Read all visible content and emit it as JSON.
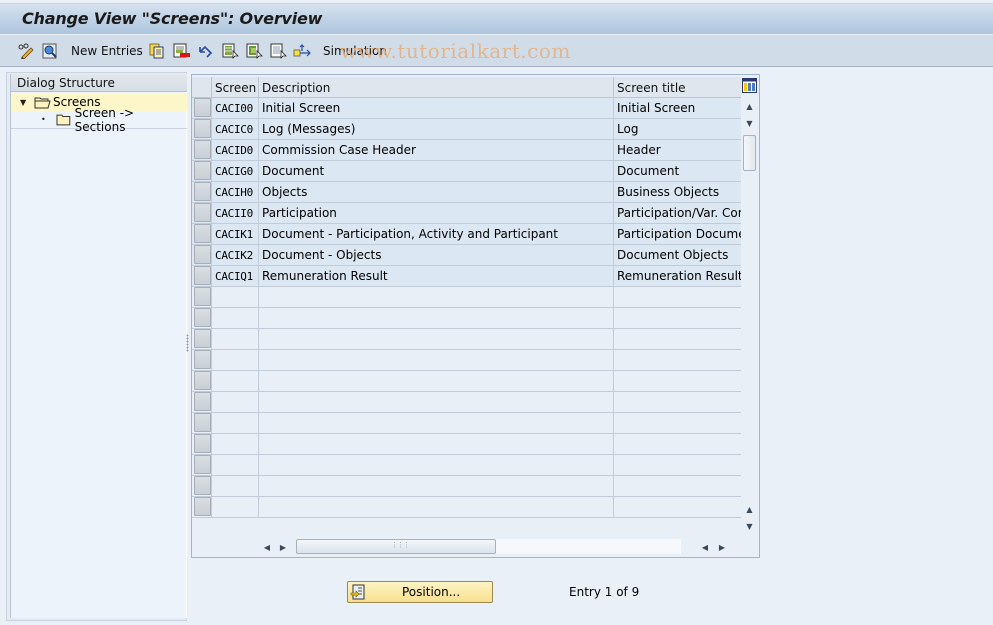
{
  "window": {
    "title": "Change View \"Screens\": Overview"
  },
  "toolbar": {
    "items": [
      {
        "icon": "change-display-icon"
      },
      {
        "icon": "find-icon"
      },
      {
        "label": "New Entries"
      },
      {
        "icon": "copy-as-icon"
      },
      {
        "icon": "delete-icon"
      },
      {
        "icon": "undo-change-icon"
      },
      {
        "icon": "select-all-icon"
      },
      {
        "icon": "select-block-icon"
      },
      {
        "icon": "deselect-all-icon"
      },
      {
        "icon": "transport-icon"
      }
    ],
    "new_entries_label": "New Entries",
    "simulation_label": "Simulation",
    "watermark": "www.tutorialkart.com"
  },
  "dialog_structure": {
    "header": "Dialog Structure",
    "items": [
      {
        "label": "Screens",
        "level": 0,
        "expanded": true,
        "selected": true
      },
      {
        "label": "Screen -> Sections",
        "level": 1,
        "expanded": false,
        "selected": false
      }
    ]
  },
  "table": {
    "columns": [
      "Screen",
      "Description",
      "Screen title"
    ],
    "rows": [
      {
        "screen": "CACI00",
        "description": "Initial Screen",
        "screen_title": "Initial Screen"
      },
      {
        "screen": "CACIC0",
        "description": "Log (Messages)",
        "screen_title": "Log"
      },
      {
        "screen": "CACID0",
        "description": "Commission Case Header",
        "screen_title": "Header"
      },
      {
        "screen": "CACIG0",
        "description": "Document",
        "screen_title": "Document"
      },
      {
        "screen": "CACIH0",
        "description": "Objects",
        "screen_title": "Business Objects"
      },
      {
        "screen": "CACII0",
        "description": "Participation",
        "screen_title": "Participation/Var. Comm"
      },
      {
        "screen": "CACIK1",
        "description": "Document - Participation, Activity and Participant",
        "screen_title": "Participation Document"
      },
      {
        "screen": "CACIK2",
        "description": "Document - Objects",
        "screen_title": "Document Objects"
      },
      {
        "screen": "CACIQ1",
        "description": "Remuneration Result",
        "screen_title": "Remuneration Result"
      }
    ],
    "empty_rows": 11
  },
  "footer": {
    "position_label": "Position...",
    "entry_text": "Entry 1 of 9"
  }
}
